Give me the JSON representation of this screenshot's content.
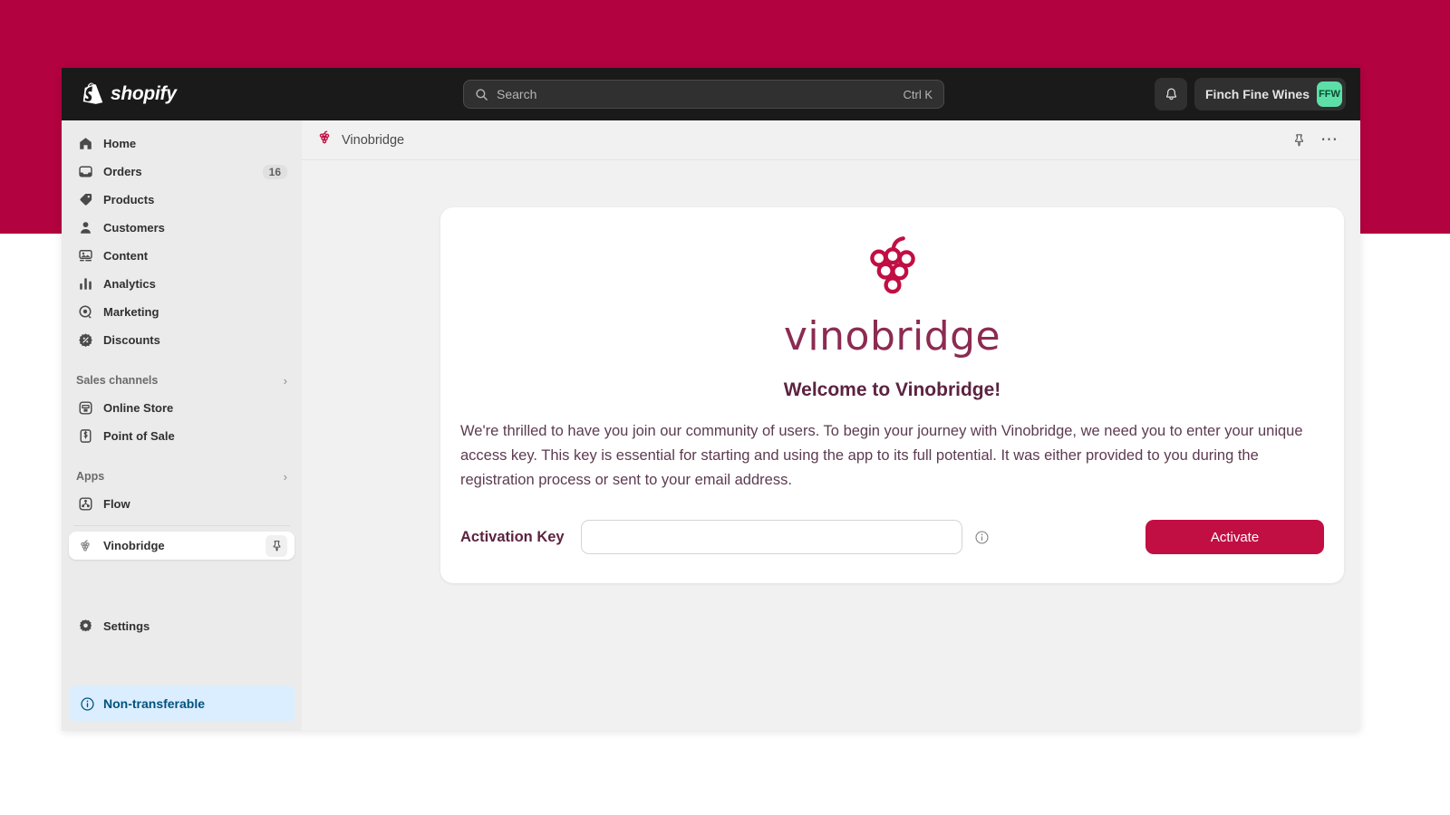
{
  "theme": {
    "backdrop_color": "#b2023f",
    "brand_crimson": "#c10f43",
    "wordmark_color": "#8c2b52",
    "avatar_color": "#5ce0a8",
    "banner_bg": "#dbeeff",
    "banner_text_color": "#00527c"
  },
  "topbar": {
    "brand": "shopify",
    "brand_icon": "shopify-bag-icon",
    "search": {
      "icon": "search-icon",
      "placeholder": "Search",
      "shortcut": "Ctrl K"
    },
    "notifications_icon": "bell-icon",
    "store_name": "Finch Fine Wines",
    "store_initials": "FFW"
  },
  "sidebar": {
    "items": [
      {
        "label": "Home",
        "icon": "home-icon"
      },
      {
        "label": "Orders",
        "icon": "orders-inbox-icon",
        "badge": "16"
      },
      {
        "label": "Products",
        "icon": "product-tag-icon"
      },
      {
        "label": "Customers",
        "icon": "person-icon"
      },
      {
        "label": "Content",
        "icon": "content-image-icon"
      },
      {
        "label": "Analytics",
        "icon": "bar-chart-icon"
      },
      {
        "label": "Marketing",
        "icon": "marketing-target-icon"
      },
      {
        "label": "Discounts",
        "icon": "discount-percent-icon"
      }
    ],
    "sales_channels": {
      "label": "Sales channels",
      "chevron": "chevron-right-icon",
      "items": [
        {
          "label": "Online Store",
          "icon": "storefront-icon"
        },
        {
          "label": "Point of Sale",
          "icon": "pos-icon"
        }
      ]
    },
    "apps": {
      "label": "Apps",
      "chevron": "chevron-right-icon",
      "items": [
        {
          "label": "Flow",
          "icon": "flow-icon"
        }
      ]
    },
    "active_app": {
      "label": "Vinobridge",
      "icon": "grape-icon",
      "pin_icon": "pin-icon"
    },
    "settings": {
      "label": "Settings",
      "icon": "gear-icon"
    },
    "banner": {
      "label": "Non-transferable",
      "icon": "info-circle-icon"
    }
  },
  "app_header": {
    "icon": "grape-icon",
    "title": "Vinobridge",
    "pin_icon": "pin-icon",
    "more_icon": "ellipsis-icon"
  },
  "card": {
    "logo_icon": "grape-cluster-logo",
    "wordmark": "vinobridge",
    "heading": "Welcome to Vinobridge!",
    "paragraph": "We're thrilled to have you join our community of users. To begin your journey with Vinobridge, we need you to enter your unique access key. This key is essential for starting and using the app to its full potential. It was either provided to you during the registration process or sent to your email address.",
    "field_label": "Activation Key",
    "field_value": "",
    "field_placeholder": "",
    "info_icon": "info-circle-icon",
    "submit_label": "Activate"
  }
}
